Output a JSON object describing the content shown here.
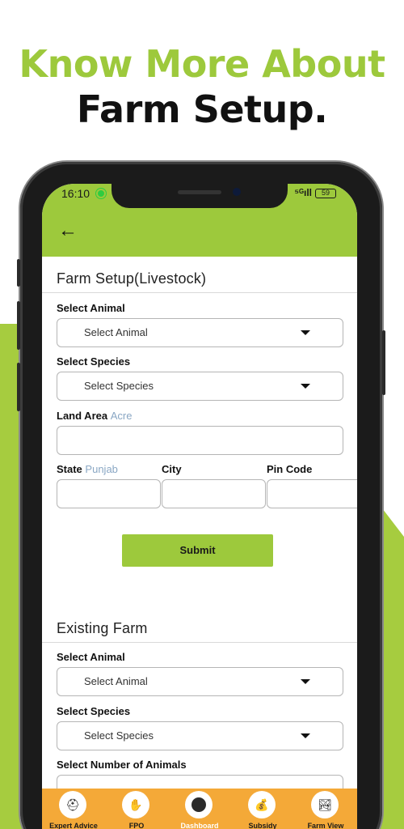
{
  "headline": {
    "line1": "Know More About",
    "line2": "Farm Setup."
  },
  "status": {
    "time": "16:10",
    "signal": "⁵ᴳıll",
    "battery": "59"
  },
  "farm_setup": {
    "title": "Farm Setup(Livestock)",
    "animal_label": "Select Animal",
    "animal_value": "Select Animal",
    "species_label": "Select Species",
    "species_value": "Select Species",
    "land_label": "Land Area",
    "land_hint": "Acre",
    "state_label": "State",
    "state_hint": "Punjab",
    "city_label": "City",
    "pin_label": "Pin Code",
    "submit_label": "Submit"
  },
  "existing_farm": {
    "title": "Existing Farm",
    "animal_label": "Select Animal",
    "animal_value": "Select Animal",
    "species_label": "Select Species",
    "species_value": "Select Species",
    "number_label": "Select Number of Animals"
  },
  "bottom_nav": [
    {
      "label": "Expert Advice",
      "icon": "expert-advice-icon"
    },
    {
      "label": "FPO",
      "icon": "hand-coin-icon"
    },
    {
      "label": "Dashboard",
      "icon": "dashboard-icon",
      "active": true
    },
    {
      "label": "Subsidy",
      "icon": "money-bag-icon"
    },
    {
      "label": "Farm View",
      "icon": "farm-view-icon"
    }
  ],
  "colors": {
    "accent": "#9dc93c",
    "nav": "#f4a938",
    "hint": "#8aa7c4"
  }
}
